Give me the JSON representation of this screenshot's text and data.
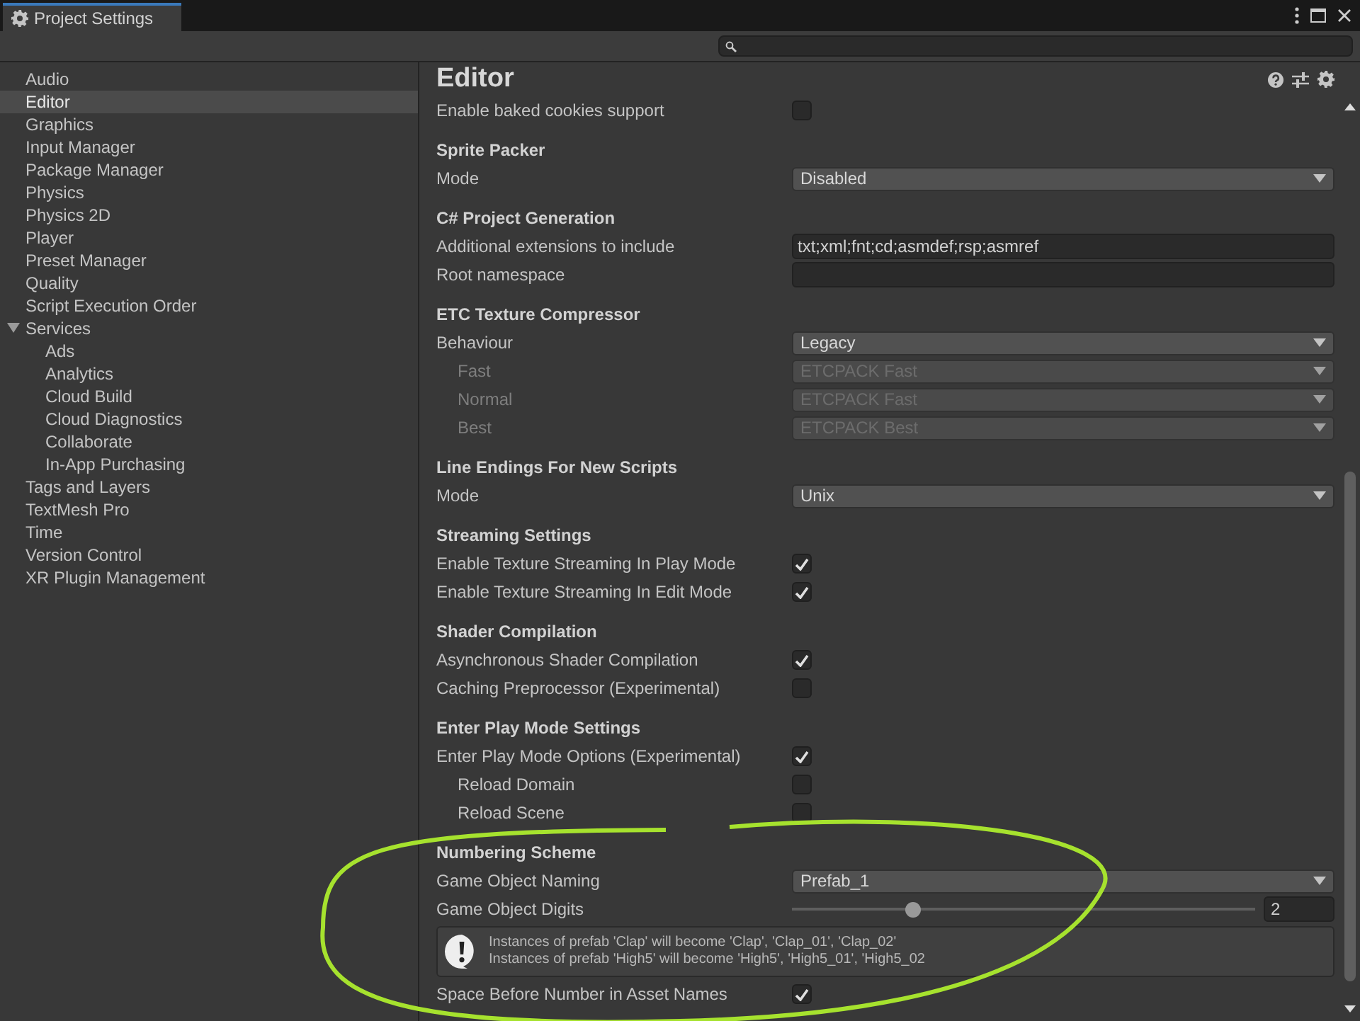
{
  "window": {
    "title": "Project Settings"
  },
  "sidebar": {
    "items": [
      {
        "label": "Audio",
        "selected": false
      },
      {
        "label": "Editor",
        "selected": true
      },
      {
        "label": "Graphics",
        "selected": false
      },
      {
        "label": "Input Manager",
        "selected": false
      },
      {
        "label": "Package Manager",
        "selected": false
      },
      {
        "label": "Physics",
        "selected": false
      },
      {
        "label": "Physics 2D",
        "selected": false
      },
      {
        "label": "Player",
        "selected": false
      },
      {
        "label": "Preset Manager",
        "selected": false
      },
      {
        "label": "Quality",
        "selected": false
      },
      {
        "label": "Script Execution Order",
        "selected": false
      },
      {
        "label": "Services",
        "selected": false,
        "expanded": true,
        "children": [
          {
            "label": "Ads",
            "selected": false
          },
          {
            "label": "Analytics",
            "selected": false
          },
          {
            "label": "Cloud Build",
            "selected": false
          },
          {
            "label": "Cloud Diagnostics",
            "selected": false
          },
          {
            "label": "Collaborate",
            "selected": false
          },
          {
            "label": "In-App Purchasing",
            "selected": false
          }
        ]
      },
      {
        "label": "Tags and Layers",
        "selected": false
      },
      {
        "label": "TextMesh Pro",
        "selected": false
      },
      {
        "label": "Time",
        "selected": false
      },
      {
        "label": "Version Control",
        "selected": false
      },
      {
        "label": "XR Plugin Management",
        "selected": false
      }
    ]
  },
  "panel": {
    "title": "Editor",
    "sections": [
      {
        "rows": [
          {
            "kind": "checkbox",
            "label": "Enable baked cookies support",
            "checked": false
          }
        ]
      },
      {
        "title": "Sprite Packer",
        "rows": [
          {
            "kind": "dropdown",
            "label": "Mode",
            "value": "Disabled",
            "disabled": false
          }
        ]
      },
      {
        "title": "C# Project Generation",
        "rows": [
          {
            "kind": "text",
            "label": "Additional extensions to include",
            "value": "txt;xml;fnt;cd;asmdef;rsp;asmref"
          },
          {
            "kind": "text",
            "label": "Root namespace"
          }
        ]
      },
      {
        "title": "ETC Texture Compressor",
        "rows": [
          {
            "kind": "dropdown",
            "label": "Behaviour",
            "value": "Legacy",
            "disabled": false,
            "children": [
              {
                "kind": "dropdown",
                "label": "Fast",
                "value": "ETCPACK Fast",
                "disabled": true
              },
              {
                "kind": "dropdown",
                "label": "Normal",
                "value": "ETCPACK Fast",
                "disabled": true
              },
              {
                "kind": "dropdown",
                "label": "Best",
                "value": "ETCPACK Best",
                "disabled": true
              }
            ]
          }
        ]
      },
      {
        "title": "Line Endings For New Scripts",
        "rows": [
          {
            "kind": "dropdown",
            "label": "Mode",
            "value": "Unix",
            "disabled": false
          }
        ]
      },
      {
        "title": "Streaming Settings",
        "rows": [
          {
            "kind": "checkbox",
            "label": "Enable Texture Streaming In Play Mode",
            "checked": true
          },
          {
            "kind": "checkbox",
            "label": "Enable Texture Streaming In Edit Mode",
            "checked": true
          }
        ]
      },
      {
        "title": "Shader Compilation",
        "rows": [
          {
            "kind": "checkbox",
            "label": "Asynchronous Shader Compilation",
            "checked": true
          },
          {
            "kind": "checkbox",
            "label": "Caching Preprocessor (Experimental)",
            "checked": false
          }
        ]
      },
      {
        "title": "Enter Play Mode Settings",
        "rows": [
          {
            "kind": "checkbox",
            "label": "Enter Play Mode Options (Experimental)",
            "checked": true,
            "children": [
              {
                "kind": "checkbox",
                "label": "Reload Domain",
                "checked": false
              },
              {
                "kind": "checkbox",
                "label": "Reload Scene",
                "checked": false
              }
            ]
          }
        ]
      },
      {
        "title": "Numbering Scheme",
        "rows": [
          {
            "kind": "dropdown",
            "label": "Game Object Naming",
            "value": "Prefab_1",
            "disabled": false
          },
          {
            "kind": "slider",
            "label": "Game Object Digits",
            "level": 0.26,
            "value": "2"
          },
          {
            "kind": "help",
            "lines": [
              "Instances of prefab 'Clap' will become 'Clap', 'Clap_01', 'Clap_02'",
              "Instances of prefab 'High5' will become 'High5', 'High5_01', 'High5_02"
            ]
          },
          {
            "kind": "checkbox",
            "label": "Space Before Number in Asset Names",
            "checked": true
          }
        ]
      }
    ]
  }
}
